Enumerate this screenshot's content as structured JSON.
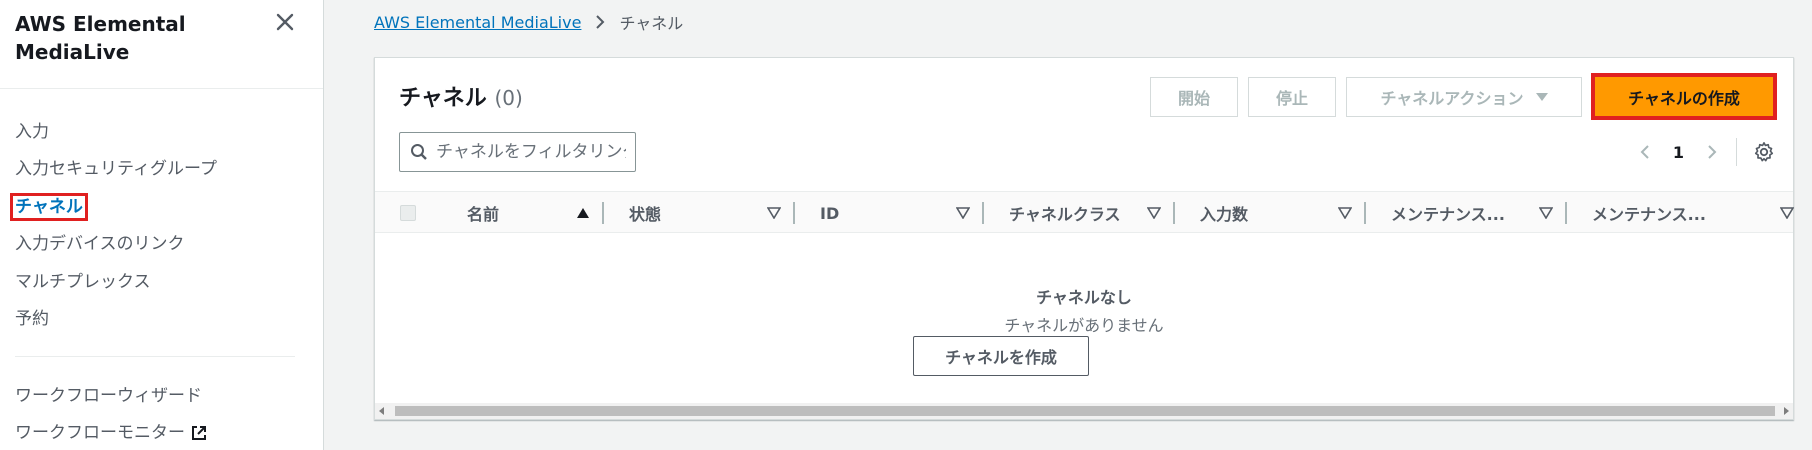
{
  "sidebar": {
    "title": "AWS Elemental MediaLive",
    "items": [
      {
        "label": "入力"
      },
      {
        "label": "入力セキュリティグループ"
      },
      {
        "label": "チャネル"
      },
      {
        "label": "入力デバイスのリンク"
      },
      {
        "label": "マルチプレックス"
      },
      {
        "label": "予約"
      }
    ],
    "items2": [
      {
        "label": "ワークフローウィザード"
      },
      {
        "label": "ワークフローモニター"
      }
    ]
  },
  "breadcrumb": {
    "root": "AWS Elemental MediaLive",
    "current": "チャネル"
  },
  "panel": {
    "title": "チャネル",
    "count": "(0)",
    "buttons": {
      "start": "開始",
      "stop": "停止",
      "actions": "チャネルアクション",
      "create": "チャネルの作成"
    },
    "filter_placeholder": "チャネルをフィルタリング",
    "page": "1"
  },
  "table": {
    "columns": [
      "名前",
      "状態",
      "ID",
      "チャネルクラス",
      "入力数",
      "メンテナンス...",
      "メンテナンス..."
    ],
    "empty_title": "チャネルなし",
    "empty_subtitle": "チャネルがありません",
    "empty_button": "チャネルを作成"
  },
  "colors": {
    "primary": "#ff9900",
    "link": "#0073bb",
    "highlight": "#e02020"
  }
}
